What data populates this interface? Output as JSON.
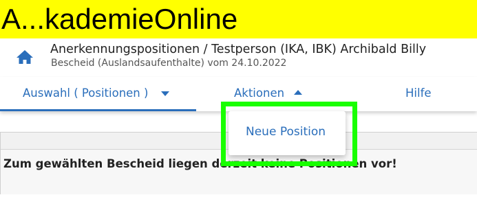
{
  "banner": {
    "title": "A...kademieOnline",
    "color": "#ffff00"
  },
  "header": {
    "home_icon": "home-icon",
    "title": "Anerkennungspositionen  / Testperson (IKA, IBK) Archibald Billy",
    "subtitle": "Bescheid (Auslandsaufenthalte) vom 24.10.2022"
  },
  "nav": {
    "items": [
      {
        "label": "Auswahl ( Positionen )",
        "icon": "caret-down-icon",
        "active": true
      },
      {
        "label": "Aktionen",
        "icon": "caret-up-icon",
        "expanded": true
      },
      {
        "label": "Hilfe"
      }
    ],
    "accent_color": "#2a6ebb"
  },
  "dropdown": {
    "items": [
      {
        "label": "Neue Position"
      }
    ]
  },
  "content": {
    "message": "Zum gewählten Bescheid liegen derzeit keine Positionen vor!"
  },
  "highlight": {
    "color": "#19ff00"
  }
}
